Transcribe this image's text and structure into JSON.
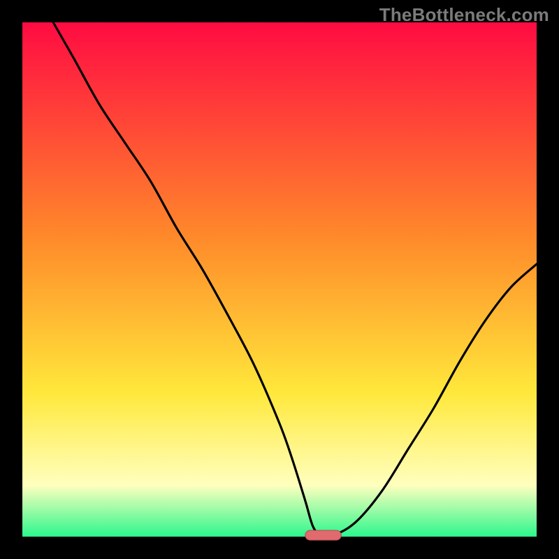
{
  "watermark": "TheBottleneck.com",
  "colors": {
    "top": "#ff0b42",
    "mid1": "#ff8a2a",
    "mid2": "#ffe83b",
    "pale": "#ffffbe",
    "green": "#2cf78c",
    "curve": "#000000",
    "marker_fill": "#e06a6e",
    "marker_stroke": "#b84a4e"
  },
  "chart_data": {
    "type": "line",
    "title": "",
    "xlabel": "",
    "ylabel": "",
    "xlim": [
      0,
      100
    ],
    "ylim": [
      0,
      100
    ],
    "series": [
      {
        "name": "bottleneck-curve",
        "x": [
          6,
          10,
          15,
          20,
          25,
          30,
          35,
          40,
          45,
          50,
          52.5,
          55,
          56.5,
          58,
          61,
          65,
          70,
          75,
          80,
          85,
          90,
          95,
          100
        ],
        "y": [
          100,
          93,
          84,
          76.5,
          69,
          60,
          52,
          43,
          33.5,
          22,
          15,
          7,
          2,
          0.5,
          0.5,
          3,
          9,
          17,
          25,
          34,
          42,
          48.5,
          53
        ]
      }
    ],
    "marker": {
      "x_start": 55,
      "x_end": 62,
      "y": 0
    },
    "annotations": []
  }
}
